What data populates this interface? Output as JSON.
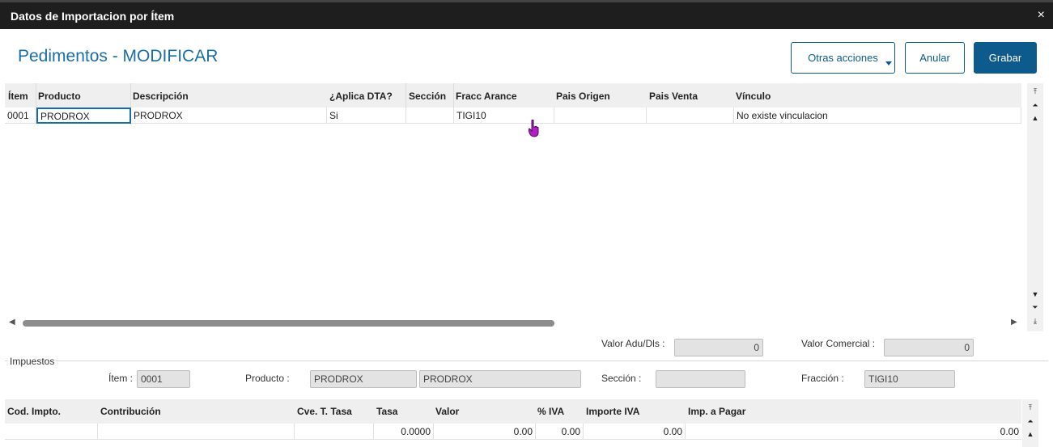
{
  "window": {
    "title": "Datos de Importacion por Ítem",
    "close_glyph": "×"
  },
  "page_title": "Pedimentos - MODIFICAR",
  "toolbar": {
    "otras_acciones": "Otras acciones",
    "anular": "Anular",
    "grabar": "Grabar"
  },
  "items_grid": {
    "columns": [
      "Ítem",
      "Producto",
      "Descripción",
      "¿Aplica DTA?",
      "Sección",
      "Fracc Arance",
      "Pais Origen",
      "Pais Venta",
      "Vínculo"
    ],
    "rows": [
      {
        "item": "0001",
        "producto": "PRODROX",
        "descripcion": "PRODROX",
        "aplica_dta": "Si",
        "seccion": "",
        "fracc_arance": "TIGI10",
        "pais_origen": "",
        "pais_venta": "",
        "vinculo": "No existe vinculacion"
      }
    ]
  },
  "totals": {
    "valor_adu_label": "Valor Adu/Dls :",
    "valor_adu_value": "0",
    "valor_comercial_label": "Valor Comercial :",
    "valor_comercial_value": "0"
  },
  "impuestos": {
    "legend": "Impuestos",
    "item_label": "Ítem :",
    "item_value": "0001",
    "producto_label": "Producto :",
    "producto_code": "PRODROX",
    "producto_desc": "PRODROX",
    "seccion_label": "Sección :",
    "seccion_value": "",
    "fraccion_label": "Fracción :",
    "fraccion_value": "TIGI10"
  },
  "tax_grid": {
    "columns": [
      "Cod. Impto.",
      "Contribución",
      "Cve. T. Tasa",
      "Tasa",
      "Valor",
      "% IVA",
      "Importe IVA",
      "Imp. a Pagar"
    ],
    "rows": [
      {
        "cod": "",
        "contribucion": "",
        "cve": "",
        "tasa": "0.0000",
        "valor": "0.00",
        "iva": "0.00",
        "importe_iva": "0.00",
        "imp_pagar": "0.00"
      }
    ]
  },
  "icons": {
    "first": "scroll-first-icon",
    "prev_page": "scroll-prev-page-icon",
    "up": "scroll-up-icon",
    "down": "scroll-down-icon",
    "next_page": "scroll-next-page-icon",
    "last": "scroll-last-icon",
    "cursor": "hand-pointer-icon"
  }
}
